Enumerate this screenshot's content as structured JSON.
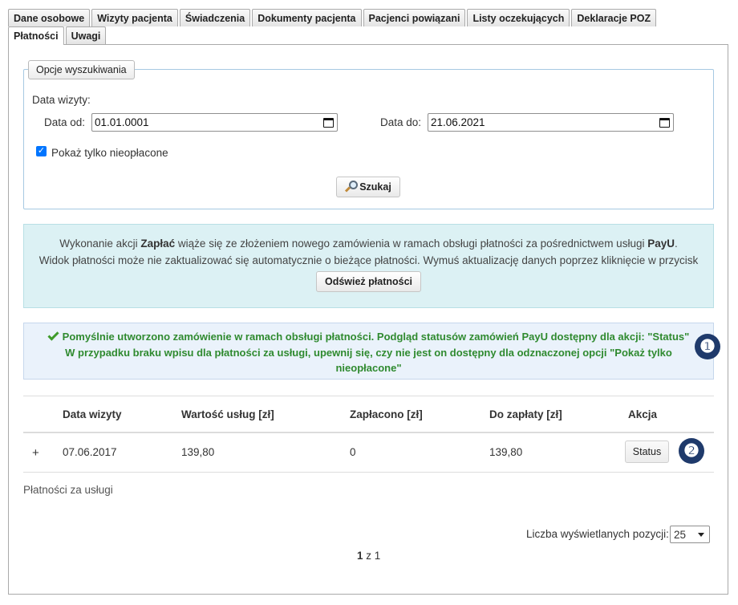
{
  "tabs_row1": [
    "Dane osobowe",
    "Wizyty pacjenta",
    "Świadczenia",
    "Dokumenty pacjenta",
    "Pacjenci powiązani",
    "Listy oczekujących",
    "Deklaracje POZ"
  ],
  "tabs_row2": [
    "Płatności",
    "Uwagi"
  ],
  "search": {
    "legend": "Opcje wyszukiwania",
    "date_label": "Data wizyty:",
    "from_label": "Data od:",
    "from_value": "01.01.0001",
    "to_label": "Data do:",
    "to_value": "21.06.2021",
    "checkbox_label": "Pokaż tylko nieopłacone",
    "checkbox_checked": true,
    "search_button": "Szukaj"
  },
  "info": {
    "line1_prefix": "Wykonanie akcji ",
    "line1_bold1": "Zapłać",
    "line1_mid": " wiąże się ze złożeniem nowego zamówienia w ramach obsługi płatności za pośrednictwem usługi ",
    "line1_bold2": "PayU",
    "line1_suffix": ".",
    "line2": "Widok płatności może nie zaktualizować się automatycznie o bieżące płatności. Wymuś aktualizację danych poprzez kliknięcie w przycisk",
    "refresh_button": "Odśwież płatności"
  },
  "success": {
    "line1": "Pomyślnie utworzono zamówienie w ramach obsługi płatności. Podgląd statusów zamówień PayU dostępny dla akcji: \"Status\"",
    "line2": "W przypadku braku wpisu dla płatności za usługi, upewnij się, czy nie jest on dostępny dla odznaczonej opcji \"Pokaż tylko",
    "line3": "nieopłacone\""
  },
  "markers": [
    "❶",
    "❷"
  ],
  "table": {
    "headers": [
      "Data wizyty",
      "Wartość usług [zł]",
      "Zapłacono [zł]",
      "Do zapłaty [zł]",
      "Akcja"
    ],
    "rows": [
      {
        "expand": "+",
        "date": "07.06.2017",
        "value": "139,80",
        "paid": "0",
        "due": "139,80",
        "action": "Status"
      }
    ]
  },
  "footer": {
    "caption": "Płatności za usługi",
    "page_size_label": "Liczba wyświetlanych pozycji:",
    "page_size_value": "25",
    "page_current": "1",
    "page_sep": "z",
    "page_total": "1"
  }
}
